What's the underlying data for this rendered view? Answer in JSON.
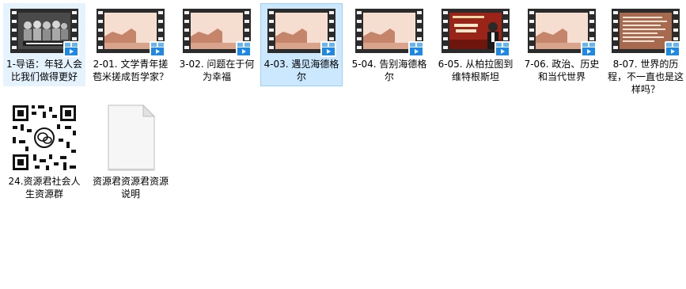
{
  "files": [
    {
      "name": "1-导语：年轻人会比我们做得更好",
      "type": "video",
      "thumb": "photo",
      "state": "hover"
    },
    {
      "name": "2-01. 文学青年搓苞米搓成哲学家？",
      "type": "video",
      "thumb": "scene",
      "state": ""
    },
    {
      "name": "3-02. 问题在于何为幸福",
      "type": "video",
      "thumb": "scene",
      "state": ""
    },
    {
      "name": "4-03. 遇见海德格尔",
      "type": "video",
      "thumb": "scene",
      "state": "selected"
    },
    {
      "name": "5-04. 告别海德格尔",
      "type": "video",
      "thumb": "scene",
      "state": ""
    },
    {
      "name": "6-05. 从柏拉图到维特根斯坦",
      "type": "video",
      "thumb": "poster",
      "state": ""
    },
    {
      "name": "7-06. 政治、历史和当代世界",
      "type": "video",
      "thumb": "scene",
      "state": ""
    },
    {
      "name": "8-07. 世界的历程，不一直也是这样吗？",
      "type": "video",
      "thumb": "text",
      "state": ""
    },
    {
      "name": "24.资源君社会人生资源群",
      "type": "qr",
      "thumb": "qr",
      "state": ""
    },
    {
      "name": "资源君资源君资源说明",
      "type": "doc",
      "thumb": "doc",
      "state": ""
    }
  ],
  "colors": {
    "selected_bg": "#cce8ff",
    "selected_border": "#99d1ff",
    "hover_bg": "#e5f3ff",
    "scene_bg": "#f5ddd0",
    "scene_hill": "#c4856a",
    "poster_bg": "#9b2418",
    "badge_blue": "#1e88e5"
  },
  "icons": {
    "video_badge": "media-player-badge-icon",
    "qr": "qr-code-image",
    "doc": "blank-document-icon"
  }
}
